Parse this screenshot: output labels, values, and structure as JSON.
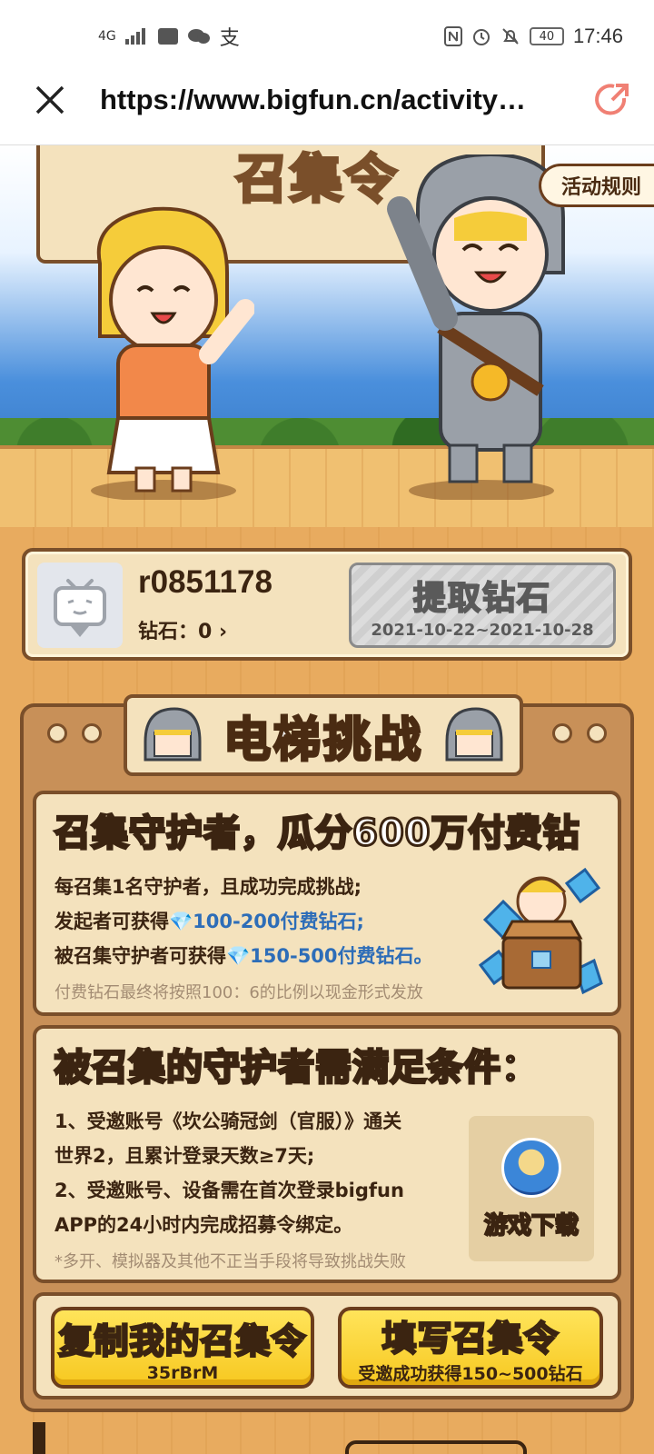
{
  "status_bar": {
    "network": "4G",
    "time": "17:46",
    "battery": "40",
    "alipay_glyph": "支"
  },
  "browser": {
    "url": "https://www.bigfun.cn/activity…",
    "close_icon": "close-icon",
    "share_icon": "share-icon"
  },
  "hero": {
    "banner_title": "召集令",
    "rules_button": "活动规则"
  },
  "user": {
    "name": "r0851178",
    "diamonds_label": "钻石：0 ›",
    "withdraw_button": "提取钻石",
    "withdraw_dates": "2021-10-22~2021-10-28"
  },
  "challenge": {
    "title": "电梯挑战",
    "section1": {
      "heading": "召集守护者，瓜分600万付费钻",
      "line1": "每召集1名守护者，且成功完成挑战;",
      "line2_prefix": "发起者可获得",
      "line2_gem": "💎100-200付费钻石;",
      "line3_prefix": "被召集守护者可获得",
      "line3_gem": "💎150-500付费钻石。",
      "note": "付费钻石最终将按照100：6的比例以现金形式发放"
    },
    "section2": {
      "heading": "被召集的守护者需满足条件：",
      "line1": "1、受邀账号《坎公骑冠剑（官服）》通关",
      "line2": "世界2，且累计登录天数≥7天;",
      "line3": "2、受邀账号、设备需在首次登录bigfun",
      "line4": "APP的24小时内完成招募令绑定。",
      "note": "*多开、模拟器及其他不正当手段将导致挑战失败",
      "download_label": "游戏下载"
    },
    "buttons": {
      "copy_title": "复制我的召集令",
      "copy_code": "35rBrM",
      "fill_title": "填写召集令",
      "fill_sub": "受邀成功获得150~500钻石"
    }
  },
  "colors": {
    "wood": "#e6a85f",
    "paper": "#f4e2bd",
    "outline": "#7a4f2a",
    "button_yellow": "#f7c820",
    "gem_blue": "#2d6db8"
  }
}
